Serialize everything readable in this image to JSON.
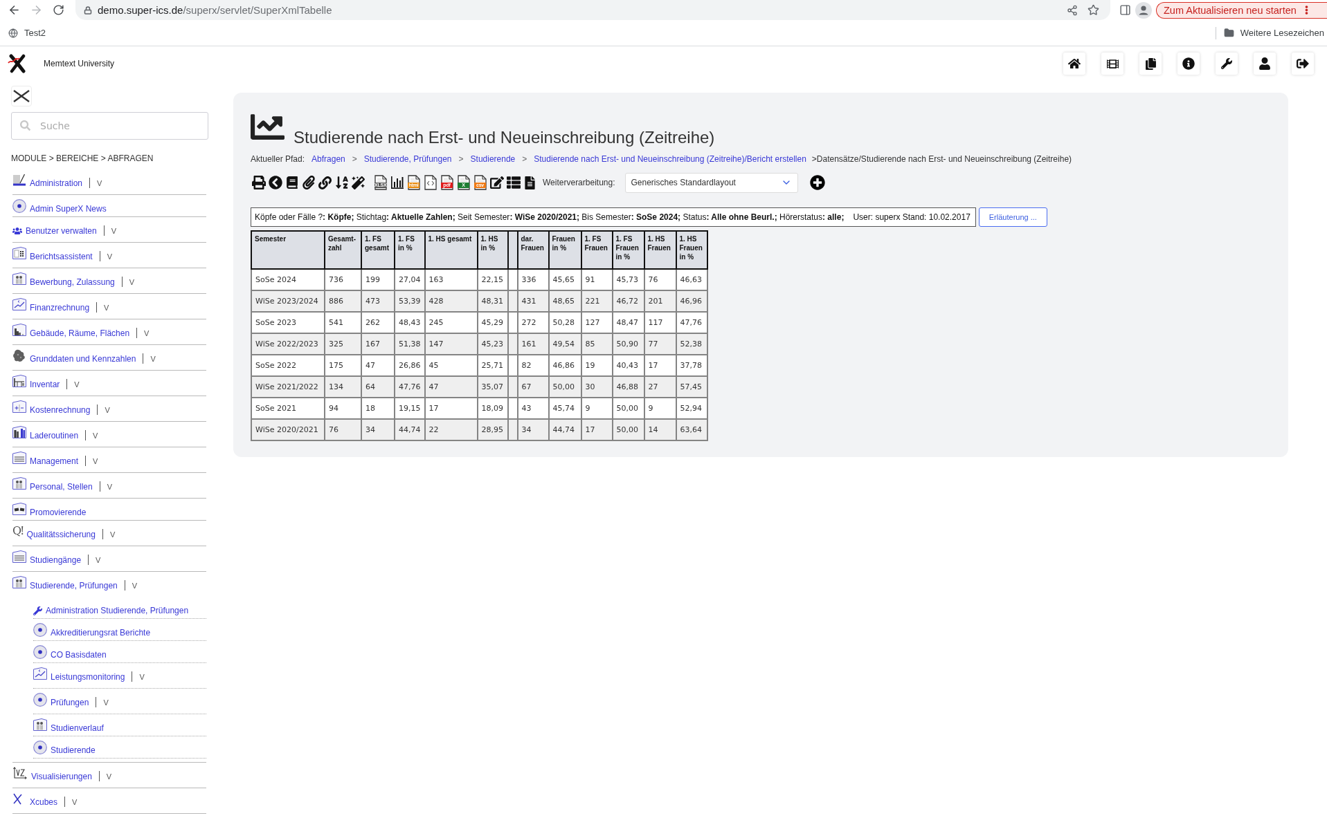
{
  "browser": {
    "back_disabled": false,
    "forward_disabled": true,
    "url": {
      "host": "demo.super-ics.de",
      "path": "/superx/servlet/SuperXmlTabelle"
    },
    "update_button": "Zum Aktualisieren neu starten",
    "bookmarks": [
      {
        "label": "Test2"
      }
    ],
    "other_bookmarks": "Weitere Lesezeichen"
  },
  "header": {
    "organization": "Memtext University"
  },
  "sidebar": {
    "search": {
      "placeholder": "Suche"
    },
    "path": "MODULE > BEREICHE > ABFRAGEN",
    "items": [
      {
        "label": "Administration",
        "toggle": "V"
      },
      {
        "label": "Admin SuperX News"
      },
      {
        "label": "Benutzer verwalten",
        "toggle": "V"
      },
      {
        "label": "Berichtsassistent",
        "toggle": "V"
      },
      {
        "label": "Bewerbung, Zulassung",
        "toggle": "V"
      },
      {
        "label": "Finanzrechnung",
        "toggle": "V"
      },
      {
        "label": "Gebäude, Räume, Flächen",
        "toggle": "V"
      },
      {
        "label": "Grunddaten und Kennzahlen",
        "toggle": "V"
      },
      {
        "label": "Inventar",
        "toggle": "V"
      },
      {
        "label": "Kostenrechnung",
        "toggle": "V"
      },
      {
        "label": "Laderoutinen",
        "toggle": "V"
      },
      {
        "label": "Management",
        "toggle": "V"
      },
      {
        "label": "Personal, Stellen",
        "toggle": "V"
      },
      {
        "label": "Promovierende"
      },
      {
        "label": "Qualitätssicherung",
        "toggle": "V",
        "glyph": "Q!"
      },
      {
        "label": "Studiengänge",
        "toggle": "V"
      },
      {
        "label": "Studierende, Prüfungen",
        "toggle": "V",
        "children": [
          {
            "label": "Administration Studierende, Prüfungen"
          },
          {
            "label": "Akkreditierungsrat Berichte"
          },
          {
            "label": "CO Basisdaten"
          },
          {
            "label": "Leistungsmonitoring",
            "toggle": "V"
          },
          {
            "label": "Prüfungen",
            "toggle": "V"
          },
          {
            "label": "Studienverlauf"
          },
          {
            "label": "Studierende"
          }
        ]
      },
      {
        "label": "Visualisierungen",
        "toggle": "V"
      },
      {
        "label": "Xcubes",
        "toggle": "V"
      }
    ]
  },
  "report": {
    "title": "Studierende nach Erst- und Neueinschreibung (Zeitreihe)",
    "breadcrumb": {
      "label": "Aktueller Pfad:",
      "items": [
        {
          "kind": "link",
          "text": "Abfragen"
        },
        {
          "kind": "separator",
          "text": ">"
        },
        {
          "kind": "link",
          "text": "Studierende, Prüfungen"
        },
        {
          "kind": "separator",
          "text": ">"
        },
        {
          "kind": "link",
          "text": "Studierende"
        },
        {
          "kind": "separator",
          "text": ">"
        },
        {
          "kind": "link",
          "text": "Studierende nach Erst- und Neueinschreibung (Zeitreihe)/Bericht erstellen"
        },
        {
          "kind": "current",
          "text": ">Datensätze/Studierende nach Erst- und Neueinschreibung (Zeitreihe)"
        }
      ]
    },
    "toolbar": {
      "exports": [
        {
          "tag": "XLSX",
          "color": "#555555"
        },
        {
          "tag": "html",
          "color": "#e8890c"
        },
        {
          "tag": "pdf",
          "color": "#e01b1b"
        },
        {
          "tag": "X",
          "color": "#1e7d32"
        },
        {
          "tag": "csv",
          "color": "#ef7a14"
        }
      ],
      "label": "Weiterverarbeitung:",
      "layout_select": {
        "value": "Generisches Standardlayout"
      }
    },
    "filter": {
      "summary": "Köpfe oder Fälle ?**: Köpfe;** Stichtag**: Aktuelle Zahlen;** Seit Semester**: WiSe 2020/2021;** Bis Semester**: SoSe 2024;** Status**: Alle ohne Beurl.;** Hörerstatus**: alle;**",
      "user_info": "User: superx Stand: 10.02.2017",
      "explain_button": "Erläuterung ..."
    },
    "table": {
      "columns": [
        {
          "kind": "data",
          "label": "Semester"
        },
        {
          "kind": "data",
          "label": "Gesamt-zahl"
        },
        {
          "kind": "data",
          "label": "1. FS gesamt"
        },
        {
          "kind": "data",
          "label": "1. FS in %"
        },
        {
          "kind": "data",
          "label": "1. HS gesamt"
        },
        {
          "kind": "data",
          "label": "1. HS in %"
        },
        {
          "kind": "spacer"
        },
        {
          "kind": "data",
          "label": "dar. Frauen"
        },
        {
          "kind": "data",
          "label": "Frauen in %"
        },
        {
          "kind": "data",
          "label": "1. FS Frauen"
        },
        {
          "kind": "data",
          "label": "1. FS Frauen in %"
        },
        {
          "kind": "data",
          "label": "1. HS Frauen"
        },
        {
          "kind": "data",
          "label": "1. HS Frauen in %"
        }
      ],
      "rows": [
        [
          "SoSe 2024",
          "736",
          "199",
          "27,04",
          "163",
          "22,15",
          "",
          "336",
          "45,65",
          "91",
          "45,73",
          "76",
          "46,63"
        ],
        [
          "WiSe 2023/2024",
          "886",
          "473",
          "53,39",
          "428",
          "48,31",
          "",
          "431",
          "48,65",
          "221",
          "46,72",
          "201",
          "46,96"
        ],
        [
          "SoSe 2023",
          "541",
          "262",
          "48,43",
          "245",
          "45,29",
          "",
          "272",
          "50,28",
          "127",
          "48,47",
          "117",
          "47,76"
        ],
        [
          "WiSe 2022/2023",
          "325",
          "167",
          "51,38",
          "147",
          "45,23",
          "",
          "161",
          "49,54",
          "85",
          "50,90",
          "77",
          "52,38"
        ],
        [
          "SoSe 2022",
          "175",
          "47",
          "26,86",
          "45",
          "25,71",
          "",
          "82",
          "46,86",
          "19",
          "40,43",
          "17",
          "37,78"
        ],
        [
          "WiSe 2021/2022",
          "134",
          "64",
          "47,76",
          "47",
          "35,07",
          "",
          "67",
          "50,00",
          "30",
          "46,88",
          "27",
          "57,45"
        ],
        [
          "SoSe 2021",
          "94",
          "18",
          "19,15",
          "17",
          "18,09",
          "",
          "43",
          "45,74",
          "9",
          "50,00",
          "9",
          "52,94"
        ],
        [
          "WiSe 2020/2021",
          "76",
          "34",
          "44,74",
          "22",
          "28,95",
          "",
          "34",
          "44,74",
          "17",
          "50,00",
          "14",
          "63,64"
        ]
      ]
    }
  }
}
